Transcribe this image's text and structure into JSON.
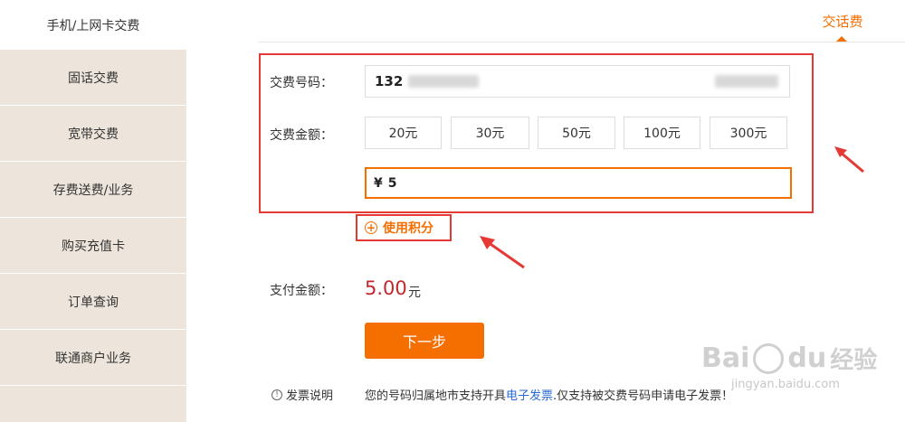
{
  "sidebar": {
    "title": "手机/上网卡交费",
    "items": [
      {
        "label": "固话交费"
      },
      {
        "label": "宽带交费"
      },
      {
        "label": "存费送费/业务"
      },
      {
        "label": "购买充值卡"
      },
      {
        "label": "订单查询"
      },
      {
        "label": "联通商户业务"
      }
    ]
  },
  "tabs": {
    "active": "交话费"
  },
  "form": {
    "phone_label": "交费号码：",
    "phone_value": "132",
    "amount_label": "交费金额：",
    "amount_options": [
      "20元",
      "30元",
      "50元",
      "100元",
      "300元"
    ],
    "custom_currency": "¥",
    "custom_value": "5",
    "points_link": "使用积分",
    "pay_label": "支付金额：",
    "pay_amount": "5.00",
    "pay_unit": "元",
    "next_button": "下一步"
  },
  "invoice": {
    "label": "发票说明",
    "text_before": "您的号码归属地市支持开具",
    "link": "电子发票",
    "text_after": ".仅支持被交费号码申请电子发票！"
  },
  "watermark": {
    "brand": "Bai",
    "brand2": "du",
    "cn": "经验",
    "url": "jingyan.baidu.com"
  },
  "colors": {
    "accent": "#f56e00",
    "highlight": "#e53935",
    "price": "#c1272d",
    "sidebar_bg": "#ede5db"
  }
}
